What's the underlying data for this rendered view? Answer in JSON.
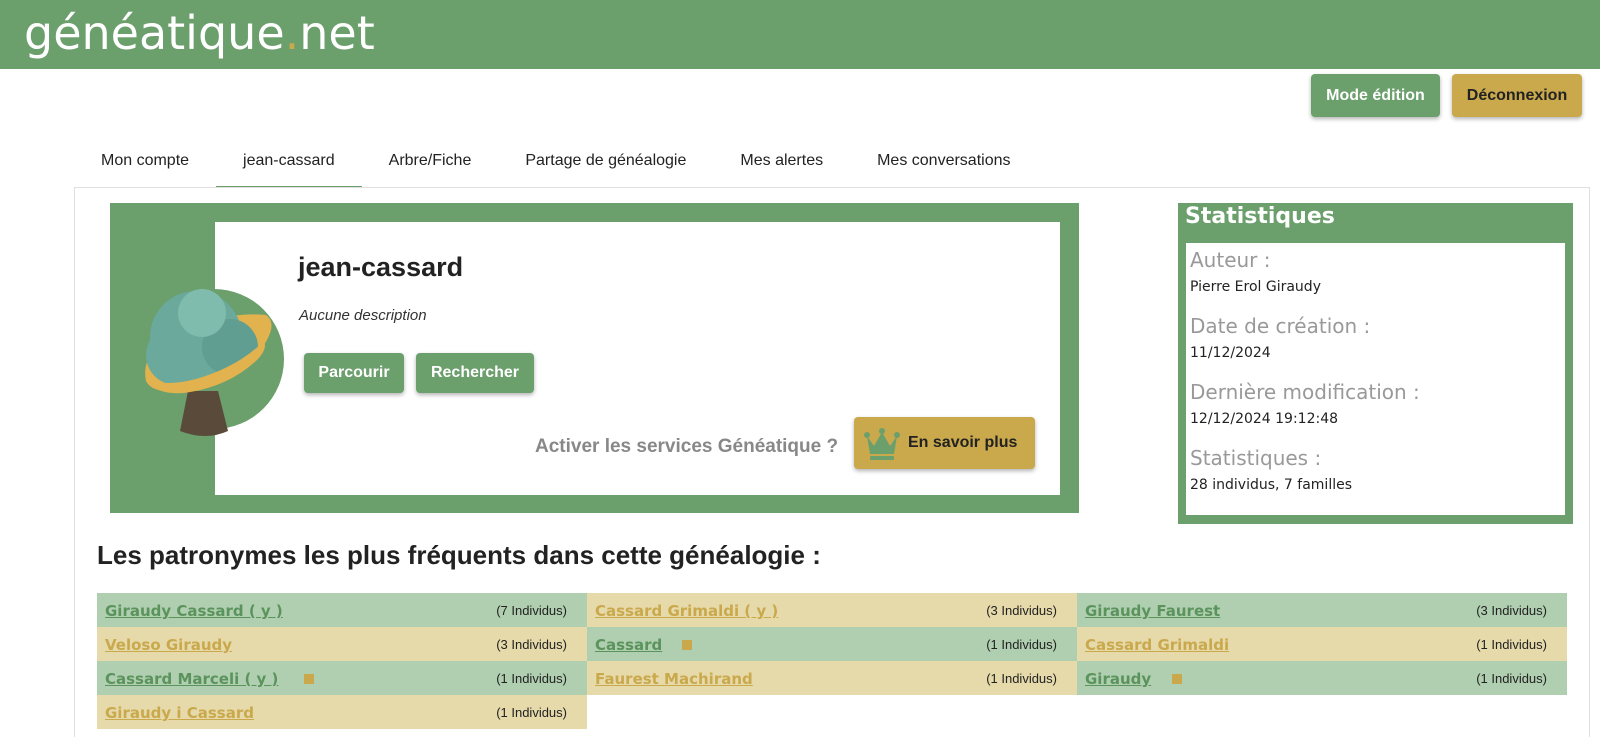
{
  "header": {
    "logo_main": "généatique",
    "logo_dot": ".",
    "logo_tld": "net",
    "colors": {
      "brand_green": "#6b9f6c",
      "brand_gold": "#c9a94c"
    }
  },
  "actions": {
    "edit_mode": "Mode édition",
    "logout": "Déconnexion"
  },
  "tabs": [
    {
      "label": "Mon compte"
    },
    {
      "label": "jean-cassard"
    },
    {
      "label": "Arbre/Fiche"
    },
    {
      "label": "Partage de généalogie"
    },
    {
      "label": "Mes alertes"
    },
    {
      "label": "Mes conversations"
    }
  ],
  "genealogy": {
    "title": "jean-cassard",
    "description": "Aucune description",
    "browse": "Parcourir",
    "search": "Rechercher",
    "services_prompt": "Activer les services Généatique ?",
    "learn_more": "En savoir plus",
    "icons": {
      "tree": "tree-icon",
      "crown": "crown-icon"
    }
  },
  "stats": {
    "title": "Statistiques",
    "author_label": "Auteur :",
    "author_value": "Pierre Erol Giraudy",
    "created_label": "Date de création :",
    "created_value": "11/12/2024",
    "modified_label": "Dernière modification :",
    "modified_value": "12/12/2024 19:12:48",
    "stats_label": "Statistiques :",
    "stats_value": "28 individus, 7 familles"
  },
  "surnames": {
    "title": "Les patronymes les plus fréquents dans cette généalogie :",
    "items": [
      {
        "name": "Giraudy Cassard ( y )",
        "count": "(7 Individus)",
        "color": "green",
        "marker": false
      },
      {
        "name": "Cassard Grimaldi ( y )",
        "count": "(3 Individus)",
        "color": "gold",
        "marker": false
      },
      {
        "name": "Giraudy Faurest",
        "count": "(3 Individus)",
        "color": "green",
        "marker": false
      },
      {
        "name": "Veloso Giraudy",
        "count": "(3 Individus)",
        "color": "gold",
        "marker": false
      },
      {
        "name": "Cassard",
        "count": "(1 Individus)",
        "color": "green",
        "marker": true
      },
      {
        "name": "Cassard Grimaldi",
        "count": "(1 Individus)",
        "color": "gold",
        "marker": false
      },
      {
        "name": "Cassard Marceli ( y )",
        "count": "(1 Individus)",
        "color": "green",
        "marker": true
      },
      {
        "name": "Faurest Machirand",
        "count": "(1 Individus)",
        "color": "gold",
        "marker": false
      },
      {
        "name": "Giraudy",
        "count": "(1 Individus)",
        "color": "green",
        "marker": true
      },
      {
        "name": "Giraudy i Cassard",
        "count": "(1 Individus)",
        "color": "gold",
        "marker": false
      }
    ]
  }
}
